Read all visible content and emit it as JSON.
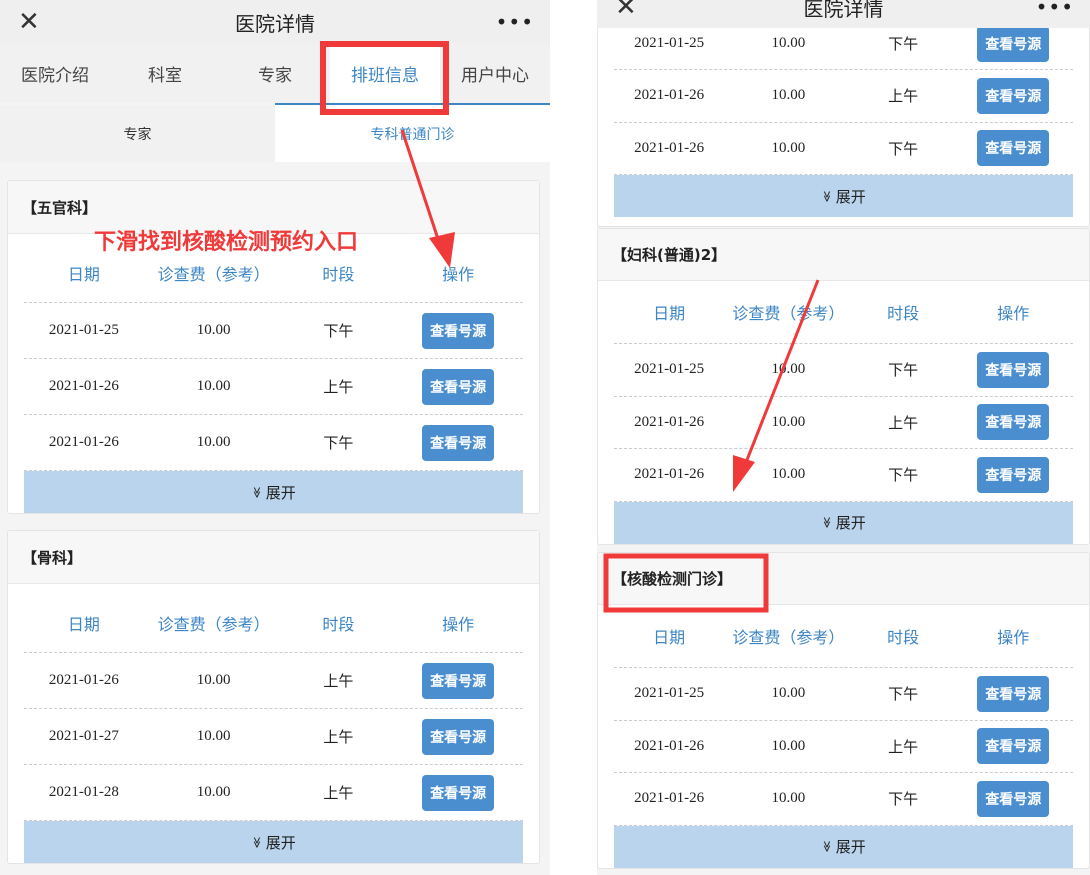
{
  "app": {
    "title": "医院详情",
    "close_icon": "close-icon",
    "more_icon": "more-icon"
  },
  "tabs": [
    {
      "label": "医院介绍"
    },
    {
      "label": "科室"
    },
    {
      "label": "专家"
    },
    {
      "label": "排班信息",
      "active": true
    },
    {
      "label": "用户中心"
    }
  ],
  "subtabs": [
    {
      "label": "专家"
    },
    {
      "label": "专科普通门诊",
      "active": true
    }
  ],
  "columns": [
    "日期",
    "诊查费（参考）",
    "时段",
    "操作"
  ],
  "button_label": "查看号源",
  "expand_label": "展开",
  "annotation": "下滑找到核酸检测预约入口",
  "colors": {
    "accent": "#3d86c6",
    "button": "#4a8ed0",
    "expand": "#b9d4ec",
    "annotation": "#f03a3a"
  },
  "left_cards": [
    {
      "name": "【五官科】",
      "rows": [
        [
          "2021-01-25",
          "10.00",
          "下午"
        ],
        [
          "2021-01-26",
          "10.00",
          "上午"
        ],
        [
          "2021-01-26",
          "10.00",
          "下午"
        ]
      ]
    },
    {
      "name": "【骨科】",
      "rows": [
        [
          "2021-01-26",
          "10.00",
          "上午"
        ],
        [
          "2021-01-27",
          "10.00",
          "上午"
        ],
        [
          "2021-01-28",
          "10.00",
          "上午"
        ]
      ]
    }
  ],
  "right_cards": [
    {
      "name": "",
      "rows": [
        [
          "2021-01-25",
          "10.00",
          "下午"
        ],
        [
          "2021-01-26",
          "10.00",
          "上午"
        ],
        [
          "2021-01-26",
          "10.00",
          "下午"
        ]
      ]
    },
    {
      "name": "【妇科(普通)2】",
      "rows": [
        [
          "2021-01-25",
          "10.00",
          "下午"
        ],
        [
          "2021-01-26",
          "10.00",
          "上午"
        ],
        [
          "2021-01-26",
          "10.00",
          "下午"
        ]
      ]
    },
    {
      "name": "【核酸检测门诊】",
      "rows": [
        [
          "2021-01-25",
          "10.00",
          "下午"
        ],
        [
          "2021-01-26",
          "10.00",
          "上午"
        ],
        [
          "2021-01-26",
          "10.00",
          "下午"
        ]
      ]
    }
  ]
}
